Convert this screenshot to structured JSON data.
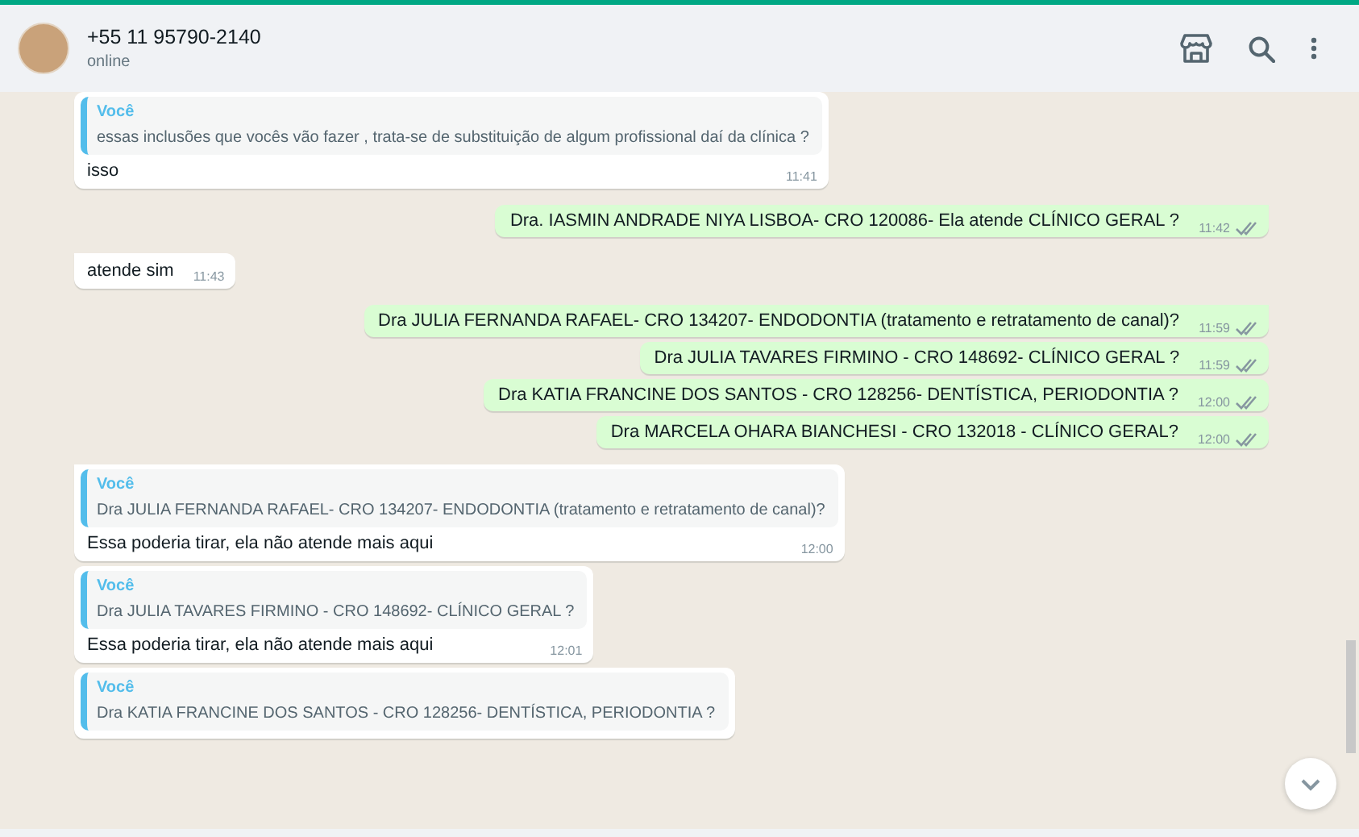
{
  "header": {
    "name": "+55 11 95790-2140",
    "status": "online"
  },
  "messages": [
    {
      "kind": "in",
      "tail": false,
      "quote": {
        "author": "Você",
        "text": "essas inclusões que vocês vão fazer , trata-se de substituição de algum profissional daí da clínica ?"
      },
      "text": "isso",
      "time": "11:41"
    },
    {
      "kind": "out",
      "tail": true,
      "text": "Dra. IASMIN ANDRADE NIYA LISBOA- CRO 120086- Ela atende CLÍNICO GERAL ?",
      "time": "11:42"
    },
    {
      "kind": "in",
      "tail": true,
      "text": "atende sim",
      "time": "11:43"
    },
    {
      "kind": "out",
      "tail": true,
      "text": "Dra JULIA FERNANDA RAFAEL- CRO 134207- ENDODONTIA  (tratamento e retratamento de canal)?",
      "time": "11:59"
    },
    {
      "kind": "out",
      "tail": false,
      "text": "Dra JULIA TAVARES FIRMINO - CRO 148692- CLÍNICO GERAL ?",
      "time": "11:59"
    },
    {
      "kind": "out",
      "tail": false,
      "text": "Dra KATIA FRANCINE DOS SANTOS - CRO 128256- DENTÍSTICA, PERIODONTIA ?",
      "time": "12:00"
    },
    {
      "kind": "out",
      "tail": false,
      "text": "Dra MARCELA OHARA BIANCHESI - CRO 132018 - CLÍNICO GERAL?",
      "time": "12:00"
    },
    {
      "kind": "in",
      "tail": true,
      "quote": {
        "author": "Você",
        "text": "Dra JULIA FERNANDA RAFAEL- CRO 134207- ENDODONTIA  (tratamento e retratamento de canal)?"
      },
      "text": "Essa poderia tirar, ela não atende mais aqui",
      "time": "12:00"
    },
    {
      "kind": "in",
      "tail": false,
      "quote": {
        "author": "Você",
        "text": "Dra JULIA TAVARES FIRMINO - CRO 148692- CLÍNICO GERAL ?"
      },
      "text": "Essa poderia tirar, ela não atende mais aqui",
      "time": "12:01"
    },
    {
      "kind": "in",
      "tail": false,
      "quote": {
        "author": "Você",
        "text": "Dra KATIA FRANCINE DOS SANTOS - CRO 128256- DENTÍSTICA, PERIODONTIA ?"
      }
    }
  ]
}
